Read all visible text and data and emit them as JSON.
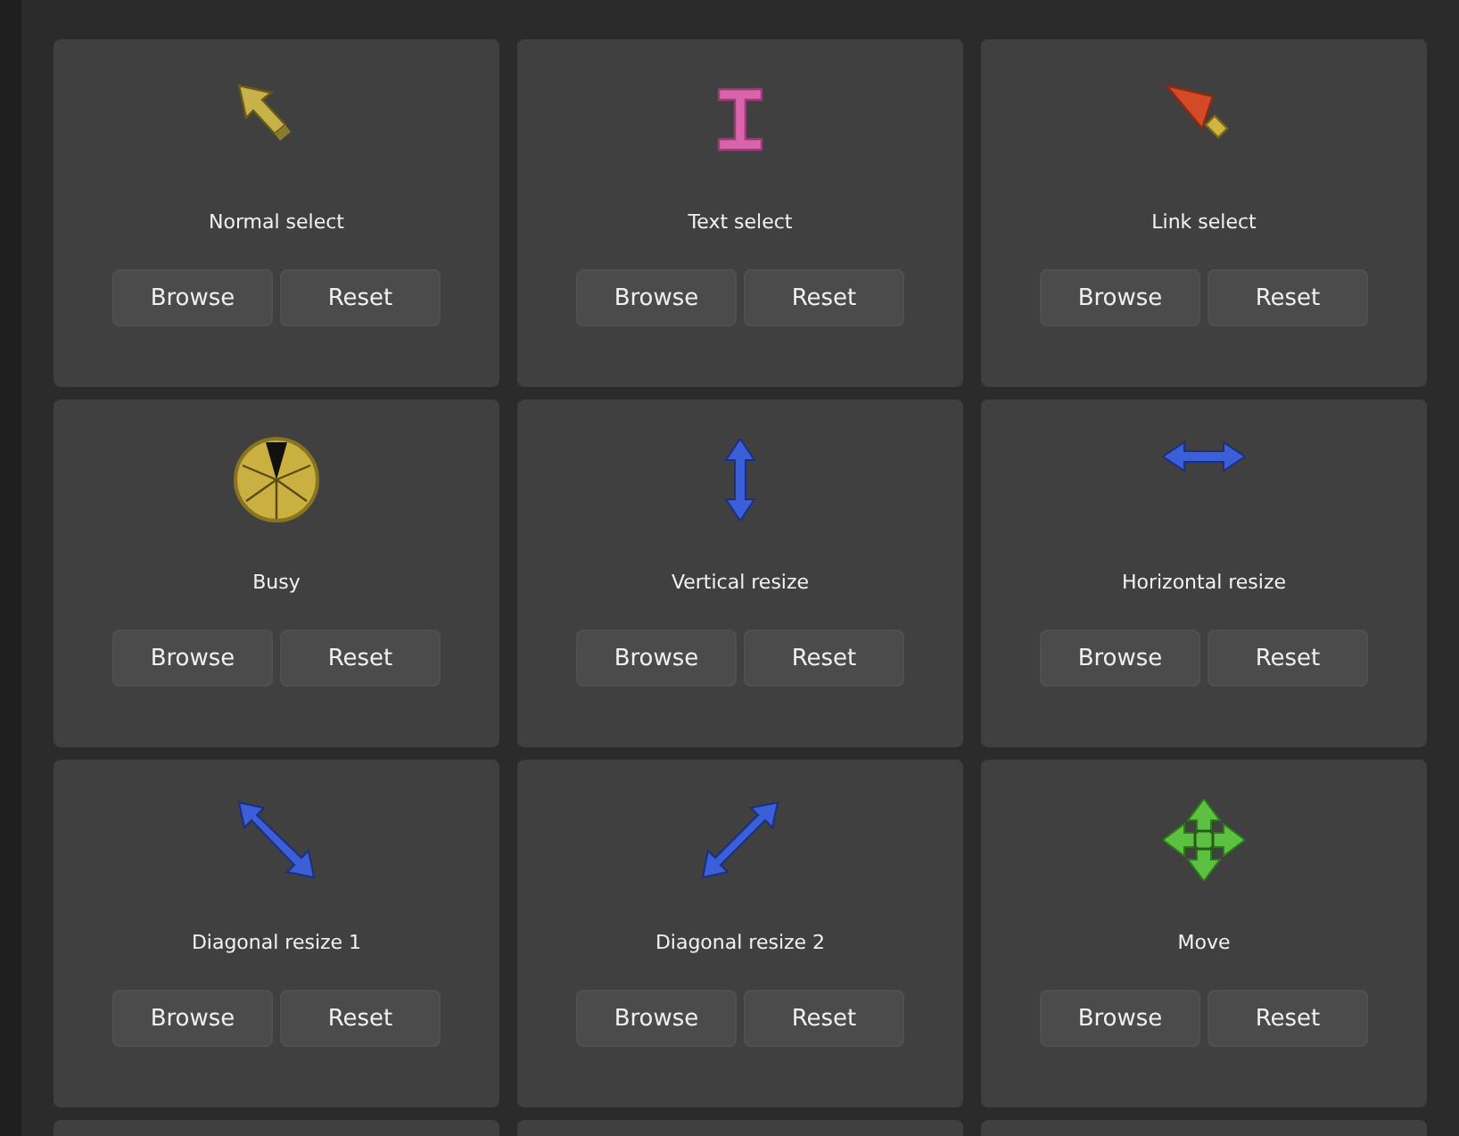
{
  "cursors": [
    {
      "kind": "arrow",
      "label": "Normal select",
      "buttons": [
        "Browse",
        "Reset"
      ]
    },
    {
      "kind": "ibeam",
      "label": "Text select",
      "buttons": [
        "Browse",
        "Reset"
      ]
    },
    {
      "kind": "link",
      "label": "Link select",
      "buttons": [
        "Browse",
        "Reset"
      ]
    },
    {
      "kind": "busy",
      "label": "Busy",
      "buttons": [
        "Browse",
        "Reset"
      ]
    },
    {
      "kind": "vresize",
      "label": "Vertical resize",
      "buttons": [
        "Browse",
        "Reset"
      ]
    },
    {
      "kind": "hresize",
      "label": "Horizontal resize",
      "buttons": [
        "Browse",
        "Reset"
      ]
    },
    {
      "kind": "dresize1",
      "label": "Diagonal resize 1",
      "buttons": [
        "Browse",
        "Reset"
      ]
    },
    {
      "kind": "dresize2",
      "label": "Diagonal resize 2",
      "buttons": [
        "Browse",
        "Reset"
      ]
    },
    {
      "kind": "move",
      "label": "Move",
      "buttons": [
        "Browse",
        "Reset"
      ]
    },
    {
      "kind": "cut"
    },
    {
      "kind": "cut"
    },
    {
      "kind": "cut"
    }
  ]
}
